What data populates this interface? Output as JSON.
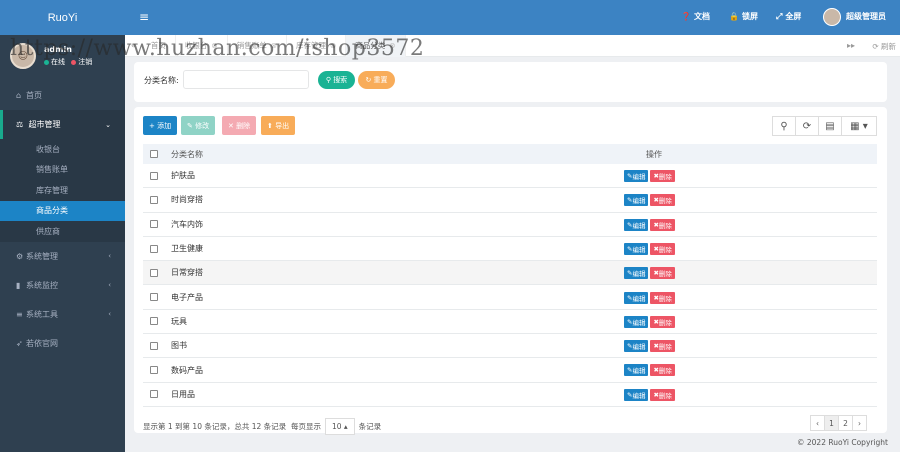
{
  "app": {
    "logo": "RuoYi"
  },
  "user": {
    "name": "admin",
    "online": "在线",
    "logout": "注销",
    "top_name": "超级管理员"
  },
  "topbar": {
    "docs": "文档",
    "lock": "锁屏",
    "fullscreen": "全屏"
  },
  "menu": {
    "home": "首页",
    "market": "超市管理",
    "market_items": [
      "收银台",
      "销售账单",
      "库存管理",
      "商品分类",
      "供应商"
    ],
    "system": "系统管理",
    "monitor": "系统监控",
    "tools": "系统工具",
    "site": "若依官网"
  },
  "tabs": {
    "items": [
      "首页",
      "收银台",
      "销售账单",
      "库存管理",
      "商品分类"
    ],
    "refresh": "刷新"
  },
  "search": {
    "label": "分类名称:",
    "search_btn": "搜索",
    "reset_btn": "重置"
  },
  "toolbar": {
    "add": "添加",
    "edit": "修改",
    "delete": "删除",
    "export": "导出"
  },
  "table": {
    "headers": [
      "分类名称",
      "操作"
    ],
    "rows": [
      "护肤品",
      "时尚穿搭",
      "汽车内饰",
      "卫生健康",
      "日常穿搭",
      "电子产品",
      "玩具",
      "图书",
      "数码产品",
      "日用品"
    ],
    "edit_label": "编辑",
    "delete_label": "删除"
  },
  "footer": {
    "range": "显示第 1 到第 10 条记录，总共 12 条记录",
    "per_page": "每页显示",
    "page_size": "10",
    "suffix": "条记录"
  },
  "pager": {
    "prev": "‹",
    "pages": [
      "1",
      "2"
    ],
    "next": "›"
  },
  "copyright": "© 2022 RuoYi Copyright",
  "watermark": "https://www.huzhan.com/ishop3572",
  "colors": {
    "sidebar": "#2f4050",
    "topbar": "#3c83c3",
    "active": "#1c84c6",
    "search": "#1ab394",
    "reset": "#f8ac59",
    "danger": "#ed5565"
  }
}
